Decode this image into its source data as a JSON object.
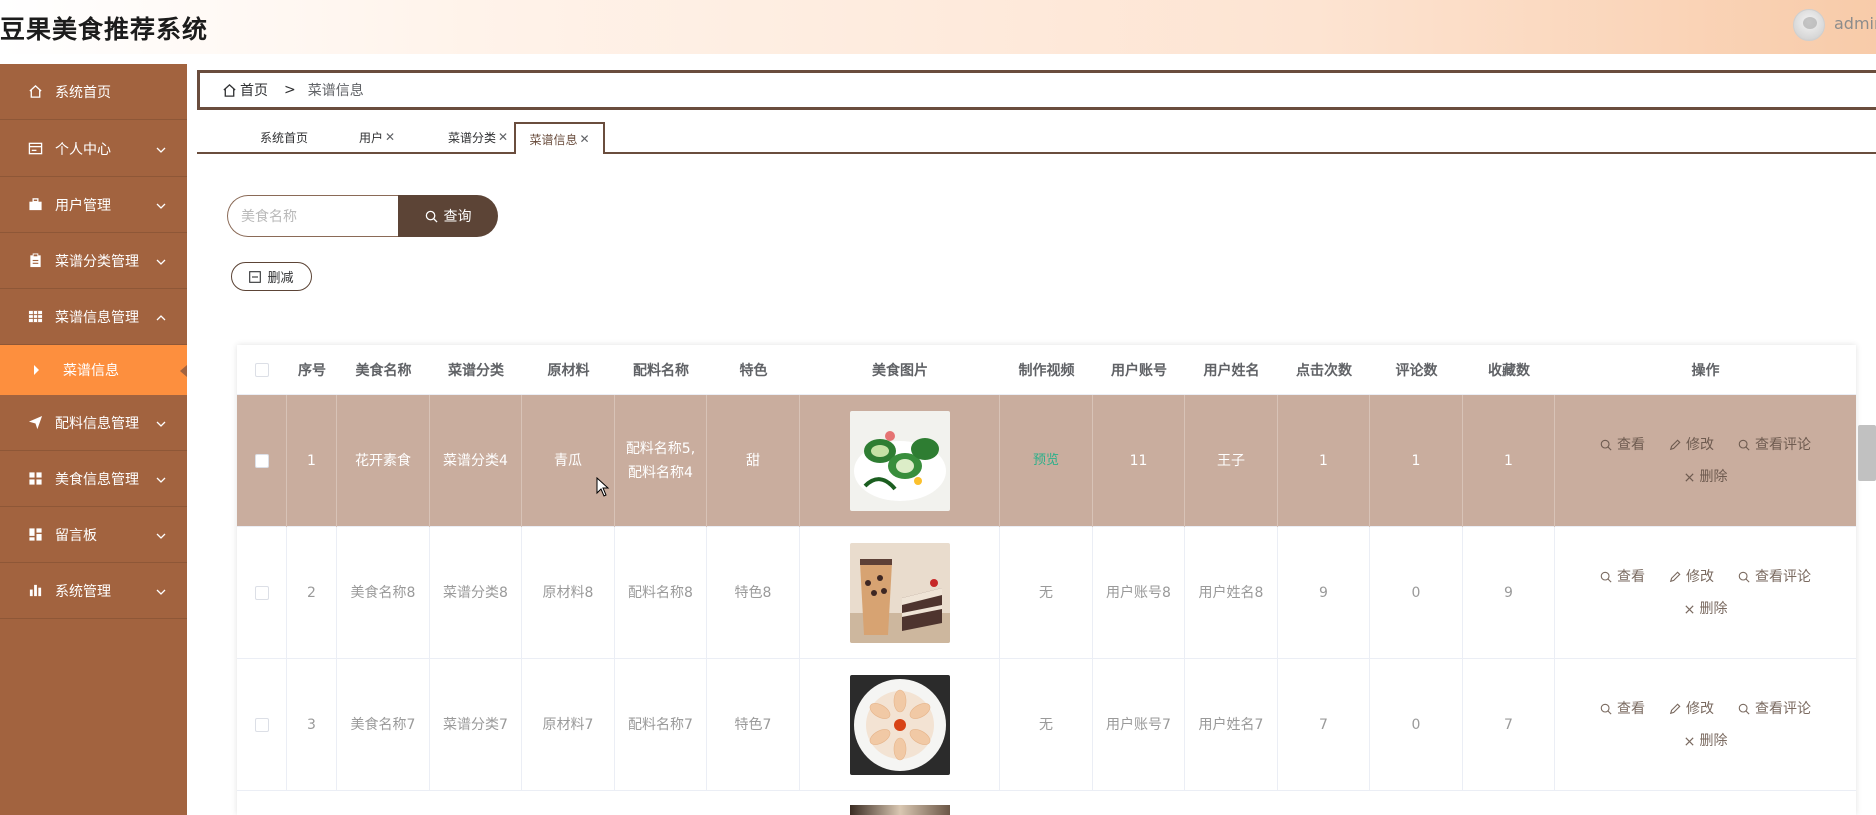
{
  "app": {
    "title": "豆果美食推荐系统",
    "username": "admin"
  },
  "sidebar": {
    "items": [
      {
        "label": "系统首页",
        "icon": "home-icon",
        "expandable": false
      },
      {
        "label": "个人中心",
        "icon": "card-icon",
        "expandable": true
      },
      {
        "label": "用户管理",
        "icon": "briefcase-icon",
        "expandable": true
      },
      {
        "label": "菜谱分类管理",
        "icon": "clipboard-icon",
        "expandable": true
      },
      {
        "label": "菜谱信息管理",
        "icon": "grid-icon",
        "expandable": true,
        "expanded": true
      },
      {
        "label": "配料信息管理",
        "icon": "send-icon",
        "expandable": true
      },
      {
        "label": "美食信息管理",
        "icon": "apps-icon",
        "expandable": true
      },
      {
        "label": "留言板",
        "icon": "dashboard-icon",
        "expandable": true
      },
      {
        "label": "系统管理",
        "icon": "chart-icon",
        "expandable": true
      }
    ],
    "active_sub": "菜谱信息"
  },
  "breadcrumb": {
    "home": "首页",
    "separator": ">",
    "current": "菜谱信息"
  },
  "tabs": [
    {
      "label": "系统首页",
      "closable": false,
      "active": false
    },
    {
      "label": "用户",
      "closable": true,
      "active": false
    },
    {
      "label": "菜谱分类",
      "closable": true,
      "active": false
    },
    {
      "label": "菜谱信息",
      "closable": true,
      "active": true
    }
  ],
  "search": {
    "placeholder": "美食名称",
    "button_label": "查询"
  },
  "toolbar": {
    "delete_label": "删减"
  },
  "table": {
    "columns": [
      "序号",
      "美食名称",
      "菜谱分类",
      "原材料",
      "配料名称",
      "特色",
      "美食图片",
      "制作视频",
      "用户账号",
      "用户姓名",
      "点击次数",
      "评论数",
      "收藏数",
      "操作"
    ],
    "rows": [
      {
        "index": "1",
        "name": "花开素食",
        "category": "菜谱分类4",
        "ingredient": "青瓜",
        "seasoning_1": "配料名称5,",
        "seasoning_2": "配料名称4",
        "feature": "甜",
        "image": "green-rolls",
        "video": "预览",
        "account": "11",
        "user_name": "王子",
        "clicks": "1",
        "comments": "1",
        "favorites": "1",
        "highlight": true
      },
      {
        "index": "2",
        "name": "美食名称8",
        "category": "菜谱分类8",
        "ingredient": "原材料8",
        "seasoning_1": "配料名称8",
        "seasoning_2": "",
        "feature": "特色8",
        "image": "milk-tea-cake",
        "video": "无",
        "account": "用户账号8",
        "user_name": "用户姓名8",
        "clicks": "9",
        "comments": "0",
        "favorites": "9",
        "highlight": false
      },
      {
        "index": "3",
        "name": "美食名称7",
        "category": "菜谱分类7",
        "ingredient": "原材料7",
        "seasoning_1": "配料名称7",
        "seasoning_2": "",
        "feature": "特色7",
        "image": "sashimi-plate",
        "video": "无",
        "account": "用户账号7",
        "user_name": "用户姓名7",
        "clicks": "7",
        "comments": "0",
        "favorites": "7",
        "highlight": false
      }
    ],
    "actions": {
      "view": "查看",
      "edit": "修改",
      "view_comments": "查看评论",
      "delete": "删除"
    }
  },
  "colors": {
    "sidebar_bg": "#a2633f",
    "sidebar_active": "#fd8f3e",
    "primary_dark": "#5c4436",
    "row_highlight": "#c9ad9e",
    "link_green": "#2bb08a"
  }
}
